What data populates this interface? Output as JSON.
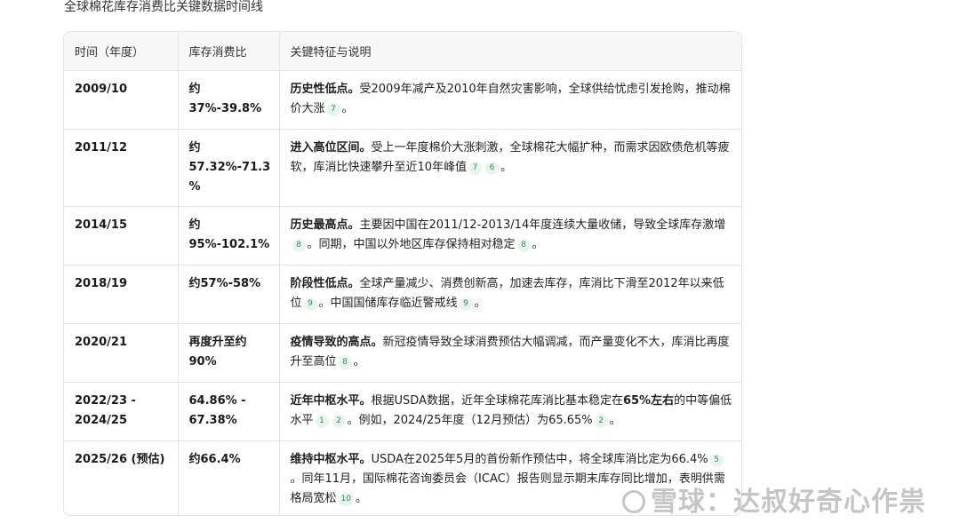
{
  "title": "全球棉花库存消费比关键数据时间线",
  "table": {
    "headers": [
      "时间（年度）",
      "库存消费比",
      "关键特征与说明"
    ],
    "rows": [
      {
        "period": "2009/10",
        "ratio_lines": [
          "约",
          "37%-39.8%"
        ],
        "desc_bold": "历史性低点。",
        "desc_segments": [
          {
            "text": "受2009年减产及2010年自然灾害影响，全球供给忧虑引发抢购，推动棉价大涨"
          },
          {
            "cite": "7"
          },
          {
            "text": "。"
          }
        ]
      },
      {
        "period": "2011/12",
        "ratio_lines": [
          "约",
          "57.32%-71.3",
          "%"
        ],
        "desc_bold": "进入高位区间。",
        "desc_segments": [
          {
            "text": "受上一年度棉价大涨刺激，全球棉花大幅扩种，而需求因欧债危机等疲软，库消比快速攀升至近10年峰值"
          },
          {
            "cite": "7"
          },
          {
            "cite": "6"
          },
          {
            "text": "。"
          }
        ]
      },
      {
        "period": "2014/15",
        "ratio_lines": [
          "约",
          "95%-102.1%"
        ],
        "desc_bold": "历史最高点。",
        "desc_segments": [
          {
            "text": "主要因中国在2011/12-2013/14年度连续大量收储，导致全球库存激增"
          },
          {
            "cite": "8"
          },
          {
            "text": "。同期，中国以外地区库存保持相对稳定"
          },
          {
            "cite": "8"
          },
          {
            "text": "。"
          }
        ]
      },
      {
        "period": "2018/19",
        "ratio_lines": [
          "约57%-58%"
        ],
        "desc_bold": "阶段性低点。",
        "desc_segments": [
          {
            "text": "全球产量减少、消费创新高，加速去库存，库消比下滑至2012年以来低位"
          },
          {
            "cite": "9"
          },
          {
            "text": "。中国国储库存临近警戒线"
          },
          {
            "cite": "9"
          },
          {
            "text": "。"
          }
        ]
      },
      {
        "period": "2020/21",
        "ratio_lines": [
          "再度升至约",
          "90%"
        ],
        "desc_bold": "疫情导致的高点。",
        "desc_segments": [
          {
            "text": "新冠疫情导致全球消费预估大幅调减，而产量变化不大，库消比再度升至高位"
          },
          {
            "cite": "8"
          },
          {
            "text": "。"
          }
        ]
      },
      {
        "period_lines": [
          "2022/23 -",
          "2024/25"
        ],
        "ratio_lines": [
          "64.86% -",
          "67.38%"
        ],
        "desc_bold": "近年中枢水平。",
        "desc_segments": [
          {
            "text": "根据USDA数据，近年全球棉花库消比基本稳定在"
          },
          {
            "bold": "65%左右"
          },
          {
            "text": "的中等偏低水平"
          },
          {
            "cite": "1"
          },
          {
            "cite": "2"
          },
          {
            "text": "。例如，2024/25年度（12月预估）为65.65%"
          },
          {
            "cite": "2"
          },
          {
            "text": "。"
          }
        ]
      },
      {
        "period": "2025/26 (预估)",
        "ratio_lines": [
          "约66.4%"
        ],
        "desc_bold": "维持中枢水平。",
        "desc_segments": [
          {
            "text": "USDA在2025年5月的首份新作预估中，将全球库消比定为66.4%"
          },
          {
            "cite": "5"
          },
          {
            "text": "。同年11月，国际棉花咨询委员会（ICAC）报告则显示期末库存同比增加，表明供需格局宽松"
          },
          {
            "cite": "10"
          },
          {
            "text": "。"
          }
        ]
      }
    ]
  },
  "watermark": "雪球：达叔好奇心作祟"
}
